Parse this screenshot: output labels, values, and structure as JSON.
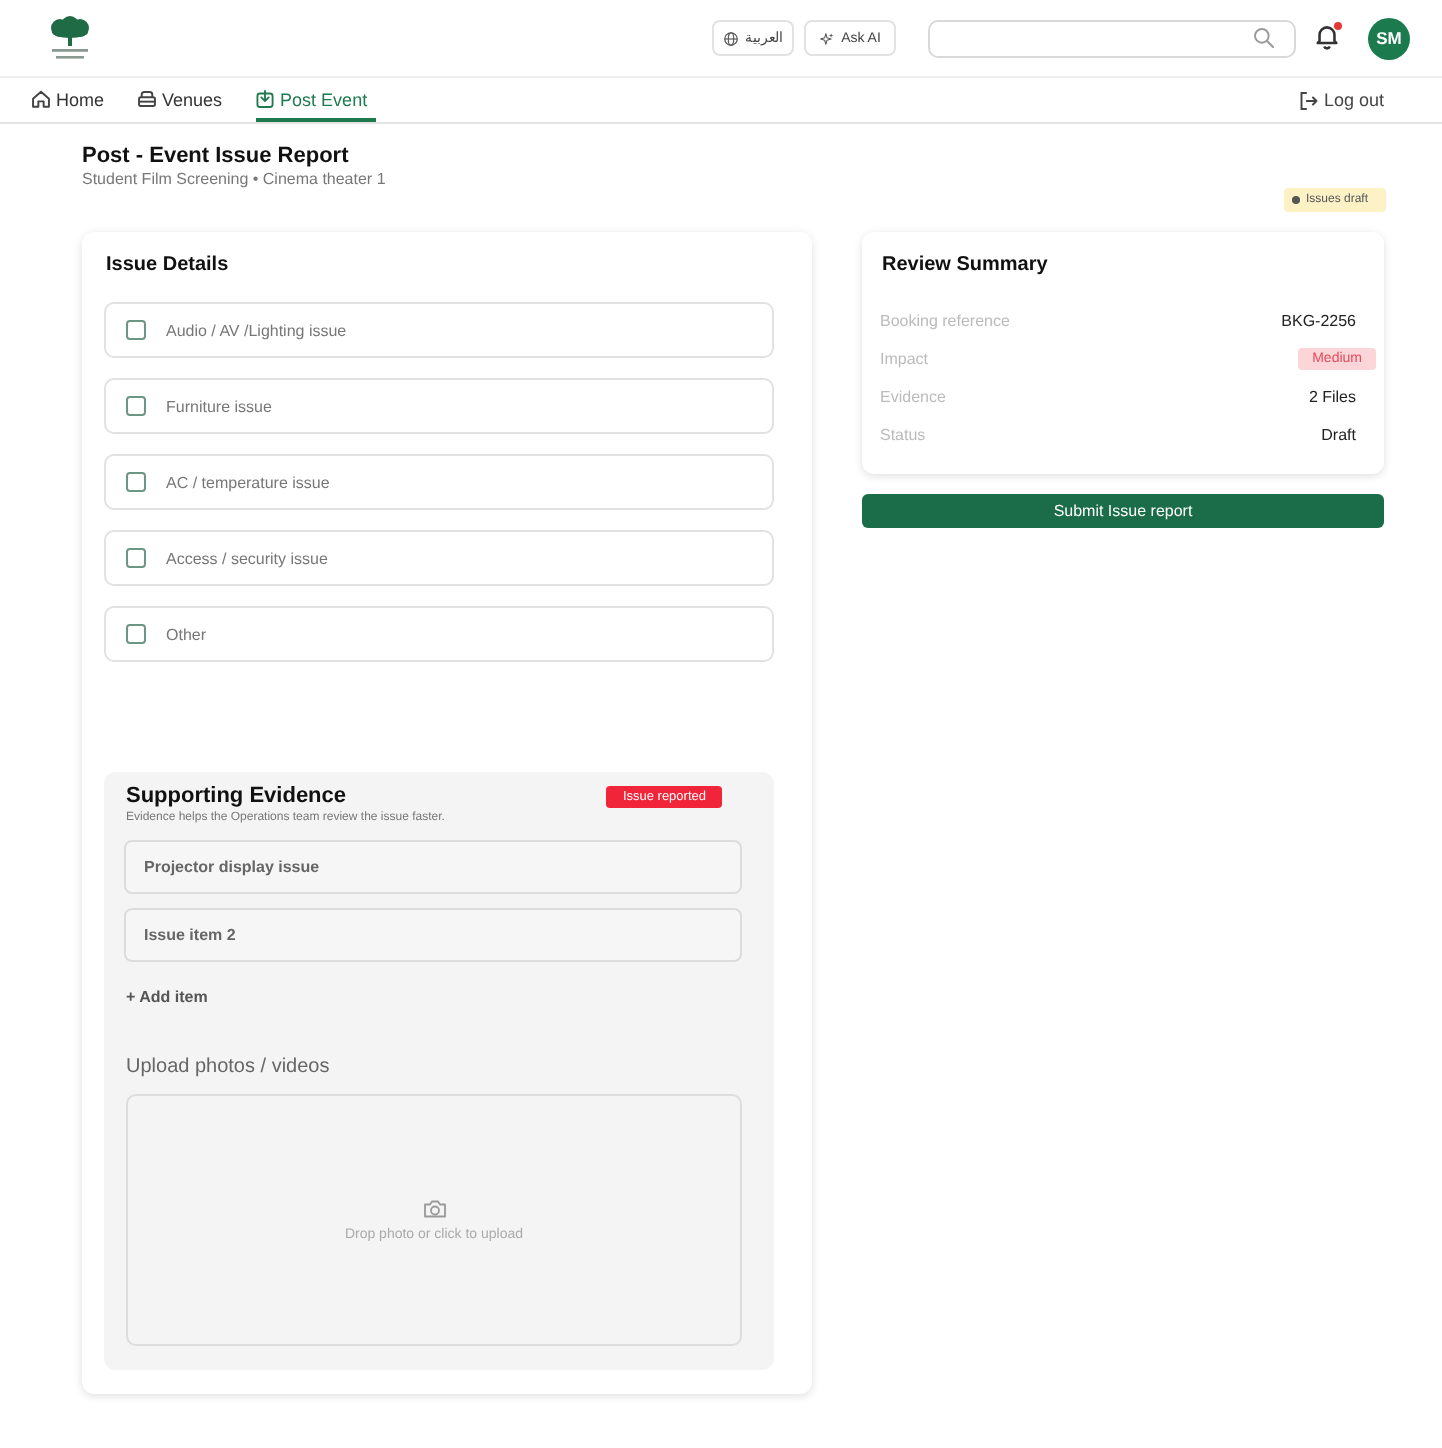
{
  "header": {
    "language_button": {
      "label": "العربية"
    },
    "ask_ai_button": {
      "label": "Ask AI"
    },
    "notifications": {
      "unread": true
    },
    "avatar": {
      "initials": "SM"
    }
  },
  "nav": {
    "tabs": [
      {
        "label": "Home",
        "selected": false
      },
      {
        "label": "Venues",
        "selected": false
      },
      {
        "label": "Post Event",
        "selected": true
      }
    ],
    "logout": {
      "label": "Log out"
    }
  },
  "page": {
    "title": "Post - Event Issue Report",
    "subtitle": "Student Film Screening • Cinema theater 1",
    "status_badge": {
      "label": "Issues draft"
    }
  },
  "issue_details": {
    "title": "Issue Details",
    "options": [
      {
        "label": "Audio / AV /Lighting issue",
        "checked": false
      },
      {
        "label": "Furniture issue",
        "checked": false
      },
      {
        "label": "AC / temperature issue",
        "checked": false
      },
      {
        "label": "Access / security issue",
        "checked": false
      },
      {
        "label": "Other",
        "checked": false
      }
    ]
  },
  "evidence": {
    "title": "Supporting Evidence",
    "badge": "Issue reported",
    "description": "Evidence helps the Operations team review the issue faster.",
    "items": [
      {
        "label": "Projector display issue"
      },
      {
        "label": "Issue item 2"
      }
    ],
    "add_item": "+ Add item",
    "upload": {
      "label": "Upload photos / videos",
      "hint": "Drop photo or click to upload"
    }
  },
  "summary": {
    "title": "Review Summary",
    "rows": [
      {
        "label": "Booking reference",
        "value": "BKG-2256",
        "kind": "text"
      },
      {
        "label": "Impact",
        "value": "Medium",
        "kind": "badge"
      },
      {
        "label": "Evidence",
        "value": "2 Files",
        "kind": "text"
      },
      {
        "label": "Status",
        "value": "Draft",
        "kind": "text"
      }
    ]
  },
  "submit_button": {
    "label": "Submit Issue report"
  }
}
